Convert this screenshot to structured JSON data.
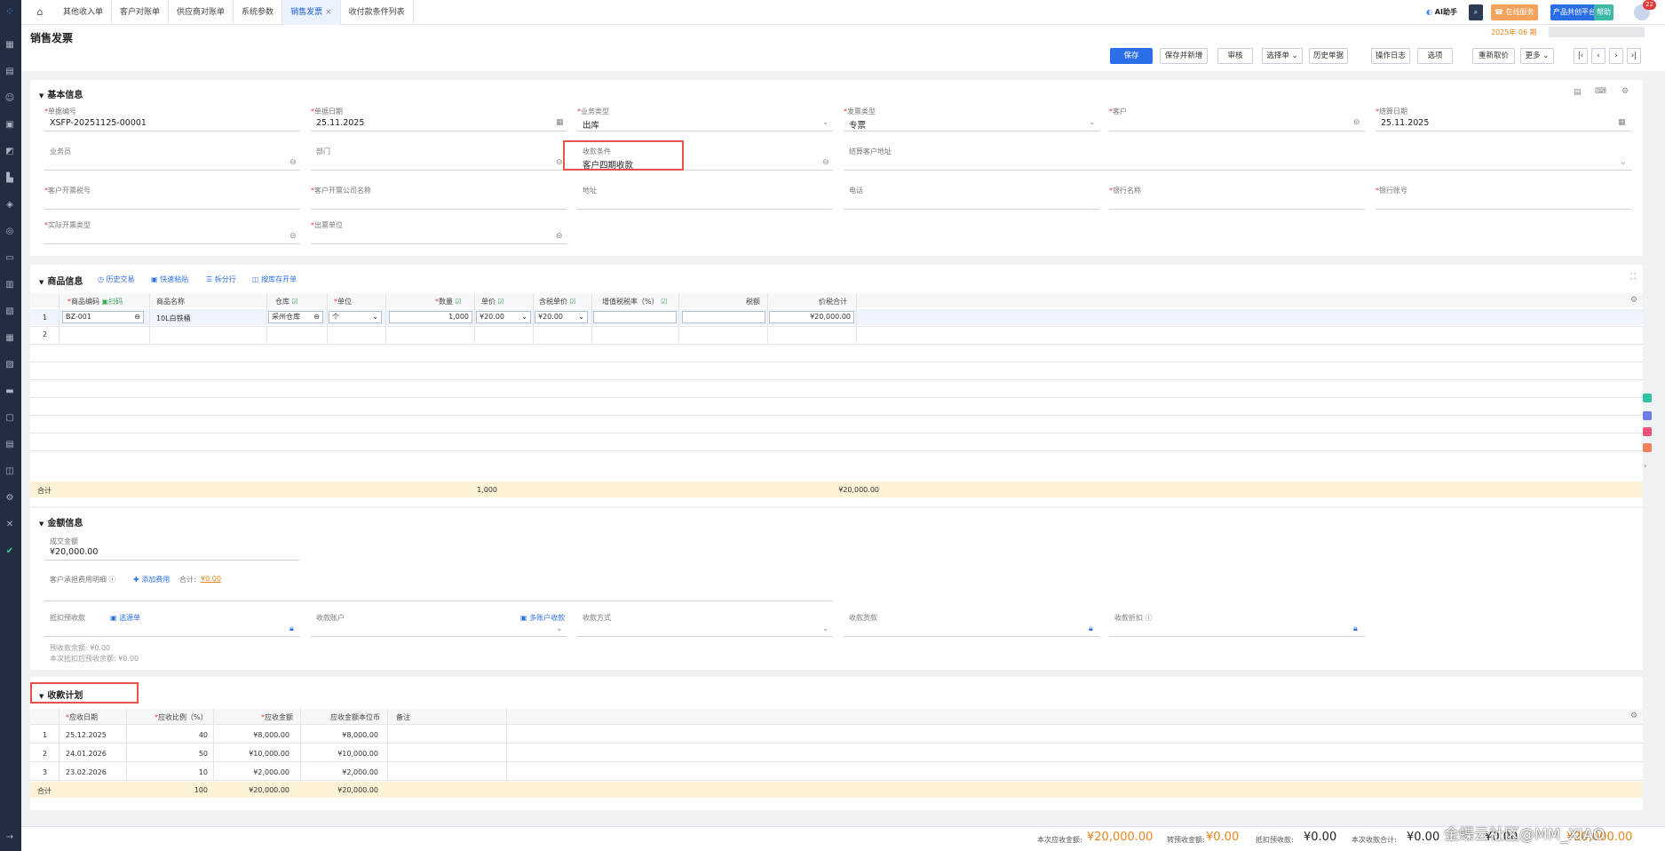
{
  "sidebar": {
    "items": [
      "grid-icon",
      "doc-icon",
      "user-icon",
      "contact-icon",
      "chart-icon",
      "cart-icon",
      "box-icon",
      "settings-icon",
      "folder-icon",
      "report-icon",
      "cash-icon",
      "calendar-icon",
      "id-icon",
      "card-icon",
      "monitor-icon",
      "archive-icon",
      "layers-icon",
      "gear-icon",
      "tools-icon",
      "check-icon"
    ]
  },
  "topbar": {
    "tabs": [
      "其他收入单",
      "客户对账单",
      "供应商对账单",
      "系统参数",
      "销售发票",
      "收付款条件列表"
    ],
    "active_tab": "销售发票",
    "ai_label": "AI助手",
    "online_service": "在线服务",
    "product_platform": "产品共创平台",
    "help": "帮助",
    "badge": "22"
  },
  "page": {
    "title": "销售发票",
    "period": "2025年 06 期",
    "buttons": {
      "save": "保存",
      "save_new": "保存并新增",
      "audit": "审核",
      "select": "选择单",
      "history": "历史单据",
      "log": "操作日志",
      "options": "选项",
      "reprice": "重新取价",
      "more": "更多"
    }
  },
  "basic": {
    "title": "基本信息",
    "bill_no_label": "单据编号",
    "bill_no": "XSFP-20251125-00001",
    "bill_date_label": "单据日期",
    "bill_date": "25.11.2025",
    "biz_type_label": "业务类型",
    "biz_type": "出库",
    "invoice_type_label": "发票类型",
    "invoice_type": "专票",
    "customer_label": "客户",
    "settle_date_label": "结算日期",
    "settle_date": "25.11.2025",
    "salesman_label": "业务员",
    "dept_label": "部门",
    "pay_term_label": "收款条件",
    "pay_term": "客户四期收款",
    "settle_addr_label": "结算客户地址",
    "tax_no_label": "客户开票税号",
    "company_label": "客户开票公司名称",
    "address_label": "地址",
    "phone_label": "电话",
    "bank_label": "银行名称",
    "bank_acct_label": "银行账号",
    "actual_type_label": "实际开票类型",
    "ship_unit_label": "出票单位"
  },
  "goods": {
    "title": "商品信息",
    "actions": [
      "历史交易",
      "快速粘贴",
      "拆分行",
      "按库存开单"
    ],
    "scan": "扫码",
    "headers": {
      "code": "商品编码",
      "name": "商品名称",
      "warehouse": "仓库",
      "unit": "单位",
      "qty": "数量",
      "price": "单价",
      "tax_price": "含税单价",
      "tax_rate": "增值税税率（%）",
      "tax": "税额",
      "total": "价税合计"
    },
    "rows": [
      {
        "no": "1",
        "code": "BZ-001",
        "name": "10L白铁桶",
        "warehouse": "采州仓库",
        "unit": "个",
        "qty": "1,000",
        "price": "¥20.00",
        "tax_price": "¥20.00",
        "tax_rate": "",
        "tax": "",
        "total": "¥20,000.00"
      },
      {
        "no": "2",
        "code": "",
        "name": "",
        "warehouse": "",
        "unit": "",
        "qty": "",
        "price": "",
        "tax_price": "",
        "tax_rate": "",
        "tax": "",
        "total": ""
      }
    ],
    "sum_label": "合计",
    "sum_qty": "1,000",
    "sum_total": "¥20,000.00"
  },
  "amount": {
    "title": "金额信息",
    "deal_label": "成交金额",
    "deal_value": "¥20,000.00",
    "fee_label": "客户承担费用明细",
    "add_fee": "添加费用",
    "fee_total_label": "合计:",
    "fee_total": "¥0.00",
    "offset_label": "抵扣预收款",
    "select_bill": "选源单",
    "acct_label": "收款账户",
    "multi_acct": "多账户收款",
    "method_label": "收款方式",
    "paid_label": "收款货款",
    "discount_label": "收款折扣",
    "prepay_balance": "预收款余额:  ¥0.00",
    "after_balance": "本次抵扣后预收余额:   ¥0.00"
  },
  "plan": {
    "title": "收款计划",
    "headers": {
      "date": "应收日期",
      "ratio": "应收比例（%）",
      "amount": "应收金额",
      "base": "应收金额本位币",
      "remark": "备注"
    },
    "rows": [
      {
        "no": "1",
        "date": "25.12.2025",
        "ratio": "40",
        "amount": "¥8,000.00",
        "base": "¥8,000.00"
      },
      {
        "no": "2",
        "date": "24.01.2026",
        "ratio": "50",
        "amount": "¥10,000.00",
        "base": "¥10,000.00"
      },
      {
        "no": "3",
        "date": "23.02.2026",
        "ratio": "10",
        "amount": "¥2,000.00",
        "base": "¥2,000.00"
      }
    ],
    "sum_label": "合计",
    "sum_ratio": "100",
    "sum_amount": "¥20,000.00",
    "sum_base": "¥20,000.00"
  },
  "bottom": {
    "receivable_label": "本次应收金额:",
    "receivable": "¥20,000.00",
    "transfer_label": "转预收金额:",
    "transfer": "¥0.00",
    "offset_label": "抵扣预收款:",
    "offset": "¥0.00",
    "received_label": "本次收款合计:",
    "received": "¥0.00",
    "extra_value": "¥0.00",
    "last_value": "¥20,000.00",
    "watermark": "金蝶云社区@MM_XIAO"
  },
  "colors": {
    "primary": "#2b6fe8",
    "sum_bg": "#fdf1d6",
    "highlight": "#e8544a",
    "orange": "#e8841a"
  }
}
